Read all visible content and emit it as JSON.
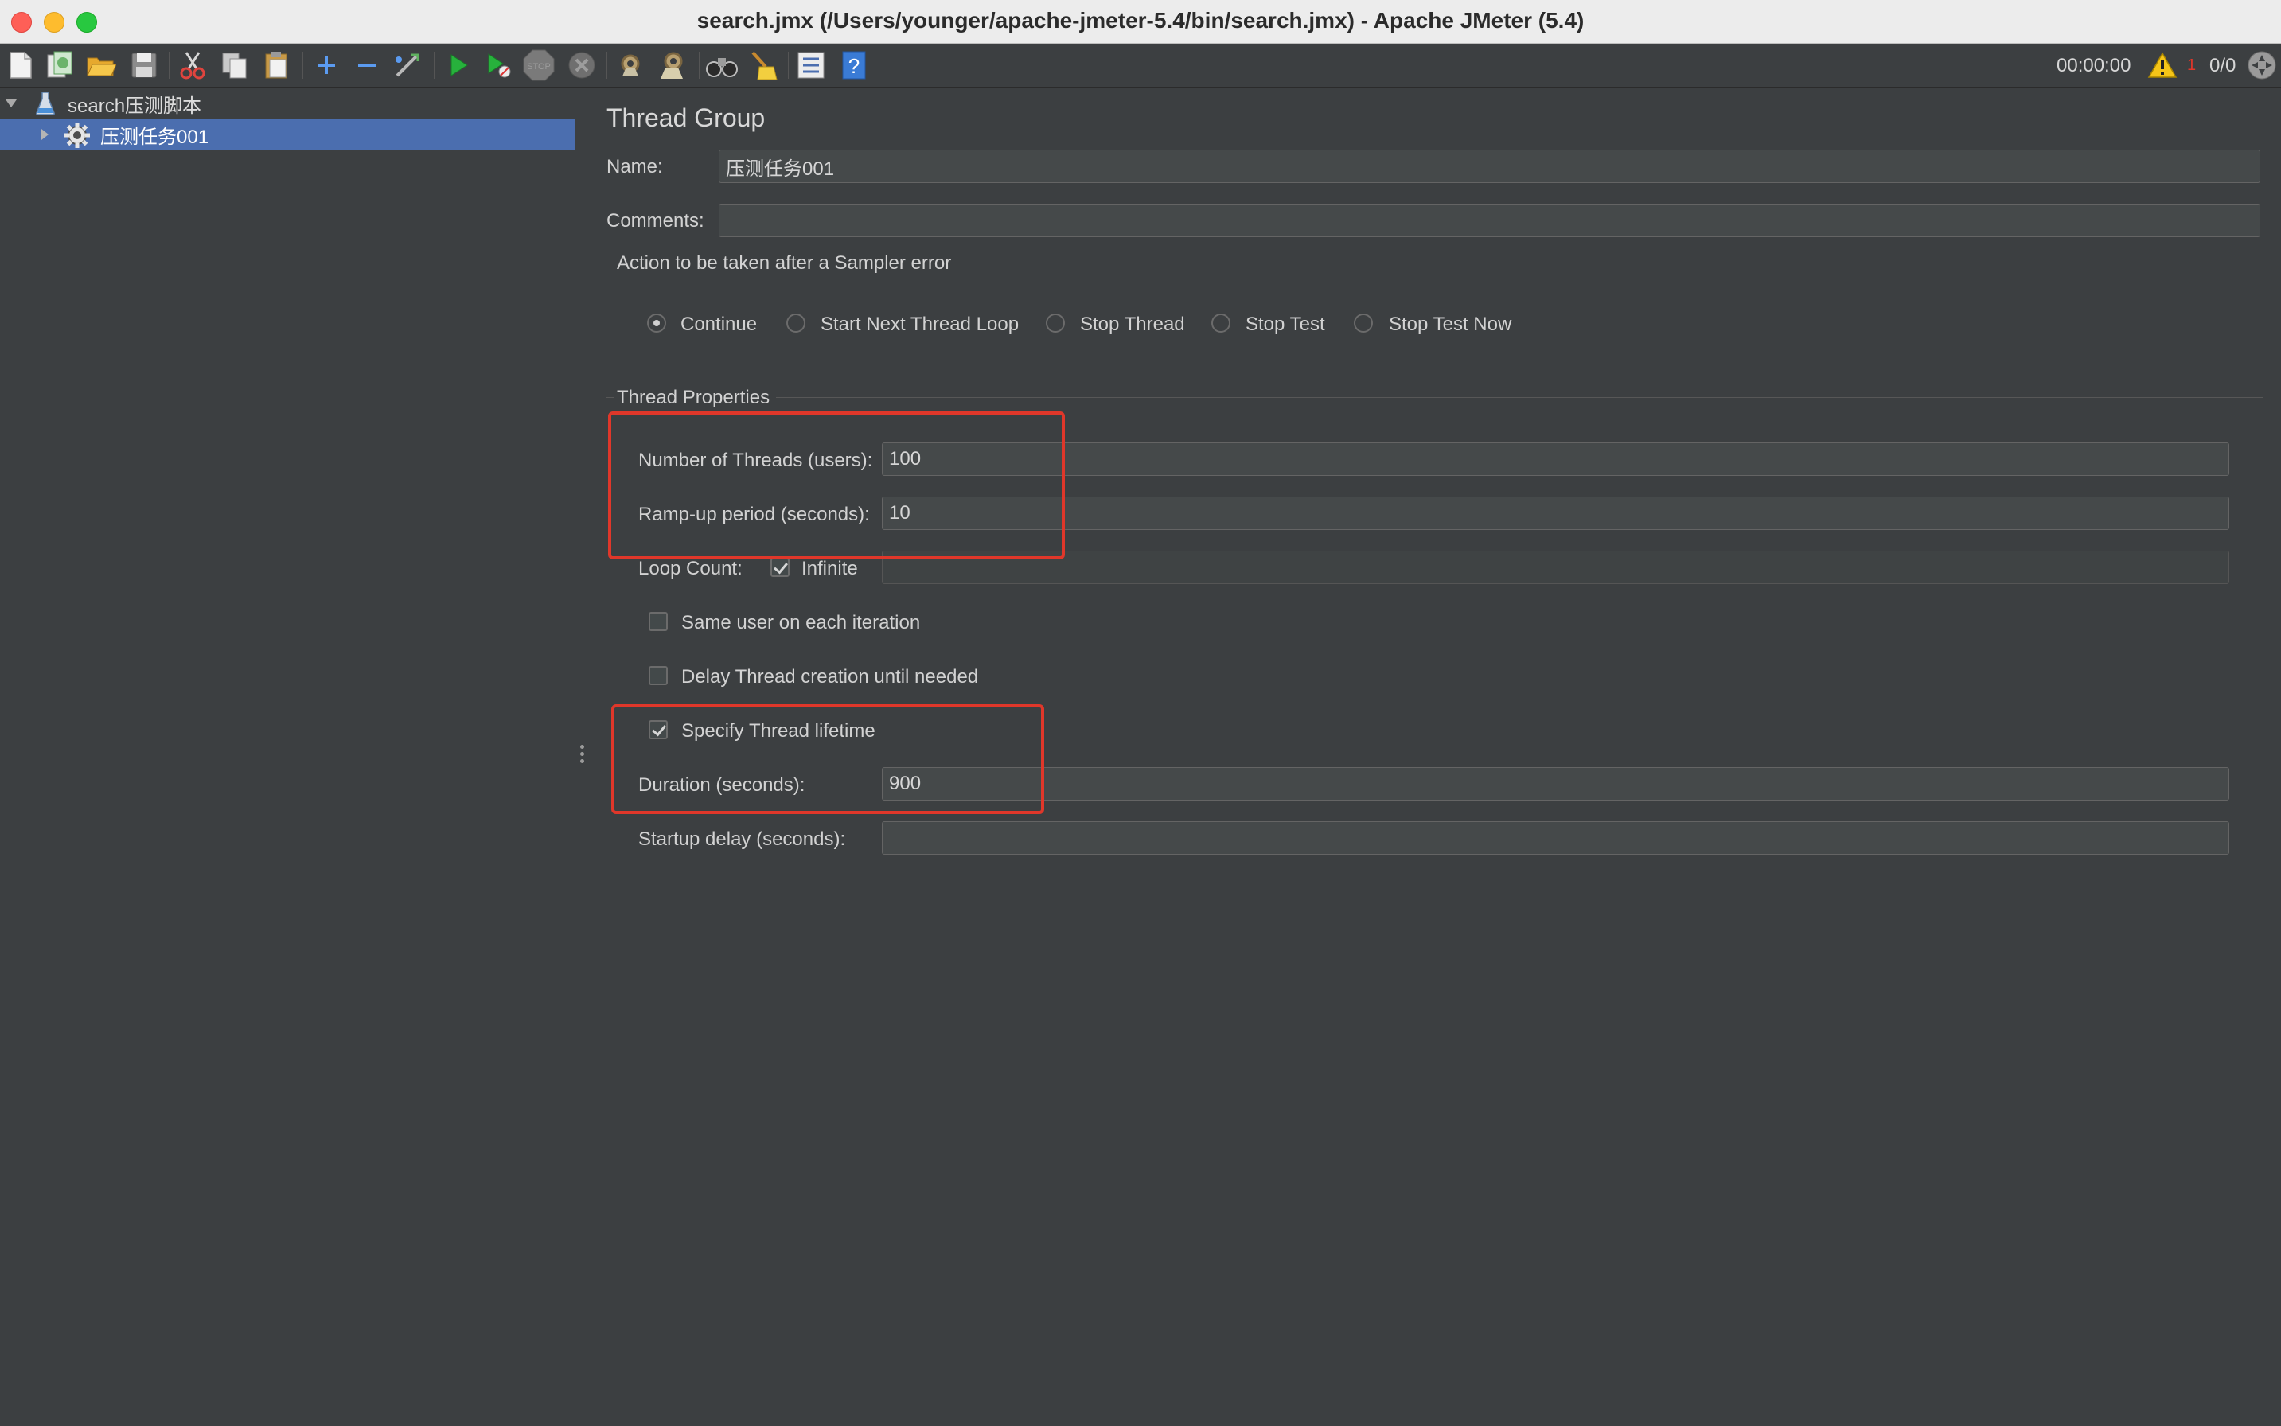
{
  "window": {
    "title": "search.jmx (/Users/younger/apache-jmeter-5.4/bin/search.jmx) - Apache JMeter (5.4)"
  },
  "toolbar": {
    "elapsed_time": "00:00:00",
    "error_count": "1",
    "threads_active": "0/0",
    "stop_label": "STOP",
    "buttons": [
      "new",
      "templates",
      "open",
      "save",
      "cut",
      "copy",
      "paste",
      "expand",
      "collapse",
      "toggle",
      "start",
      "start-no-pauses",
      "stop",
      "shutdown",
      "clear",
      "clear-all",
      "search",
      "reset-search",
      "function-helper",
      "help"
    ]
  },
  "tree": {
    "items": [
      {
        "label": "search压测脚本",
        "icon": "test-plan-icon",
        "expanded": true
      },
      {
        "label": "压测任务001",
        "icon": "thread-group-gear-icon",
        "expanded": false,
        "selected": true
      }
    ]
  },
  "panel": {
    "title": "Thread Group",
    "name_label": "Name:",
    "name_value": "压测任务001",
    "comments_label": "Comments:",
    "comments_value": "",
    "error_section": {
      "title": "Action to be taken after a Sampler error",
      "options": [
        "Continue",
        "Start Next Thread Loop",
        "Stop Thread",
        "Stop Test",
        "Stop Test Now"
      ],
      "selected": "Continue"
    },
    "thread_section": {
      "title": "Thread Properties",
      "threads_label": "Number of Threads (users):",
      "threads_value": "100",
      "rampup_label": "Ramp-up period (seconds):",
      "rampup_value": "10",
      "loop_label": "Loop Count:",
      "infinite_label": "Infinite",
      "infinite_checked": true,
      "loop_value": "",
      "same_user_label": "Same user on each iteration",
      "same_user_checked": false,
      "delay_label": "Delay Thread creation until needed",
      "delay_checked": false,
      "lifetime_label": "Specify Thread lifetime",
      "lifetime_checked": true,
      "duration_label": "Duration (seconds):",
      "duration_value": "900",
      "startup_label": "Startup delay (seconds):",
      "startup_value": ""
    }
  },
  "colors": {
    "highlight": "#e0372a",
    "selection": "#4b6eaf",
    "background": "#3c3f41"
  }
}
